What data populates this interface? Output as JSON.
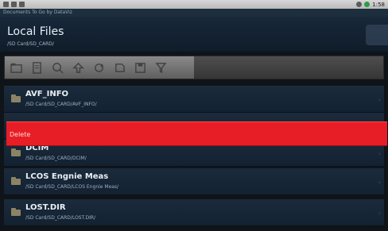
{
  "status_bar": {
    "left_icons": [
      "usb-icon",
      "notification-icon",
      "download-icon"
    ],
    "right_icons": [
      "sync-icon",
      "battery-icon"
    ],
    "time": "1:58"
  },
  "app_bar_text": "Documents To Go by DataViz",
  "header": {
    "title": "Local Files",
    "path": "/SD Card/SD_CARD/"
  },
  "toolbar": {
    "buttons": [
      "new-folder-icon",
      "new-document-icon",
      "search-icon",
      "up-directory-icon",
      "refresh-icon",
      "sd-card-icon",
      "save-icon",
      "filter-icon"
    ]
  },
  "files": [
    {
      "name": "AVF_INFO",
      "path": "/SD Card/SD_CARD/AVF_INFO/"
    },
    {
      "name": "",
      "path": ""
    },
    {
      "name": "DCIM",
      "path": "/SD Card/SD_CARD/DCIM/"
    },
    {
      "name": "LCOS Engnie Meas",
      "path": "/SD Card/SD_CARD/LCOS Engnie Meas/"
    },
    {
      "name": "LOST.DIR",
      "path": "/SD Card/SD_CARD/LOST.DIR/"
    }
  ],
  "context_menu": {
    "delete_label": "Delete"
  },
  "colors": {
    "delete_bg": "#e71e26",
    "header_bg": "#18283a",
    "row_bg": "#1b2b3c"
  }
}
